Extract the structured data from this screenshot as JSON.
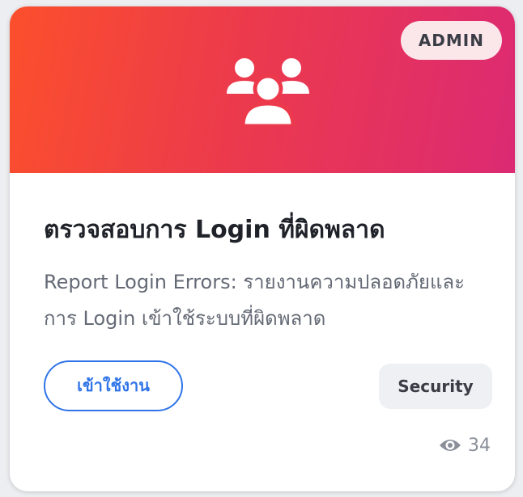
{
  "card": {
    "badge": "ADMIN",
    "banner_icon": "users-icon",
    "title": "ตรวจสอบการ Login ที่ผิดพลาด",
    "description": "Report Login Errors: รายงานความปลอดภัยและการ Login เข้าใช้ระบบที่ผิดพลาด",
    "action_label": "เข้าใช้งาน",
    "category_tag": "Security",
    "views_icon": "eye-icon",
    "view_count": "34"
  },
  "colors": {
    "banner_start": "#fb4f2c",
    "banner_end": "#dc2a73",
    "accent_blue": "#2f74e8"
  }
}
